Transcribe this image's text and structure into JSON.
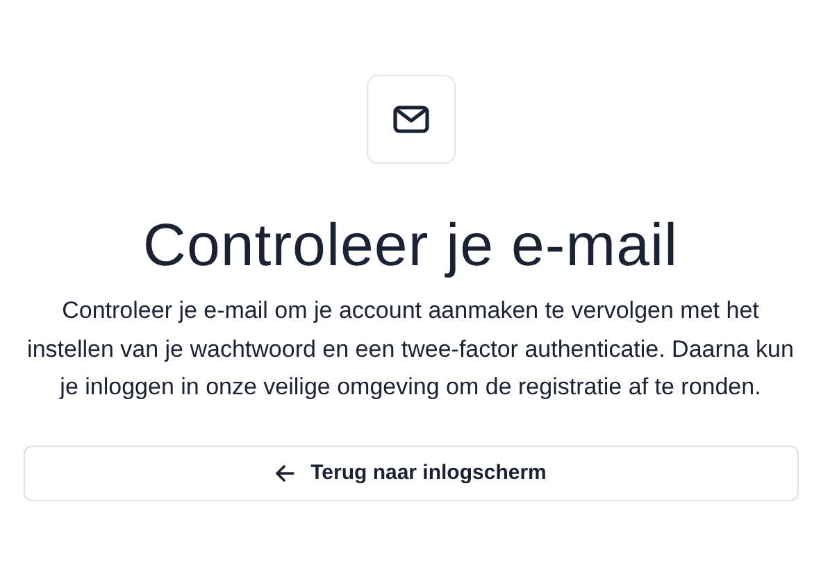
{
  "title": "Controleer je e-mail",
  "message": "Controleer je e-mail om je account aanmaken te vervolgen met het instellen van je wachtwoord en een twee-factor authenticatie. Daarna kun je inloggen in onze veilige omgeving om de registratie af te ronden.",
  "back_button": {
    "label": "Terug naar inlogscherm"
  }
}
